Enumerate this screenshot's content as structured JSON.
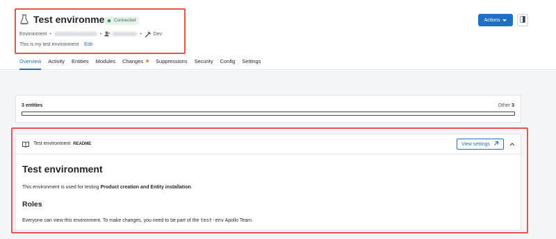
{
  "header": {
    "title": "Test environment",
    "status_badge": "Connected",
    "meta": {
      "type_label": "Environment",
      "separator": "•",
      "tag_label": "Dev"
    },
    "description": "This is my test environment",
    "edit_label": "Edit",
    "actions_label": "Actions"
  },
  "tabs": [
    {
      "label": "Overview",
      "active": true
    },
    {
      "label": "Activity"
    },
    {
      "label": "Entities"
    },
    {
      "label": "Modules"
    },
    {
      "label": "Changes",
      "has_notification": true
    },
    {
      "label": "Suppressions"
    },
    {
      "label": "Security"
    },
    {
      "label": "Config"
    },
    {
      "label": "Settings"
    }
  ],
  "entities": {
    "count_label": "3 entities",
    "other_label": "Other",
    "other_count": "3"
  },
  "readme": {
    "title": "Test environment",
    "title_suffix": "README",
    "view_settings_label": "View settings",
    "h1": "Test environment",
    "p1_before": "This environment is used for testing ",
    "p1_bold": "Product creation and Entity installation",
    "p1_after": ".",
    "h2": "Roles",
    "p2_before": "Everyone can view this environment. To make changes, you need to be part of the ",
    "p2_code": "test-env",
    "p2_after": " Apollo Team."
  },
  "colors": {
    "accent": "#1f6fc6",
    "highlight": "#e5564a",
    "connected": "#3b8a54",
    "notification": "#e8893a"
  }
}
